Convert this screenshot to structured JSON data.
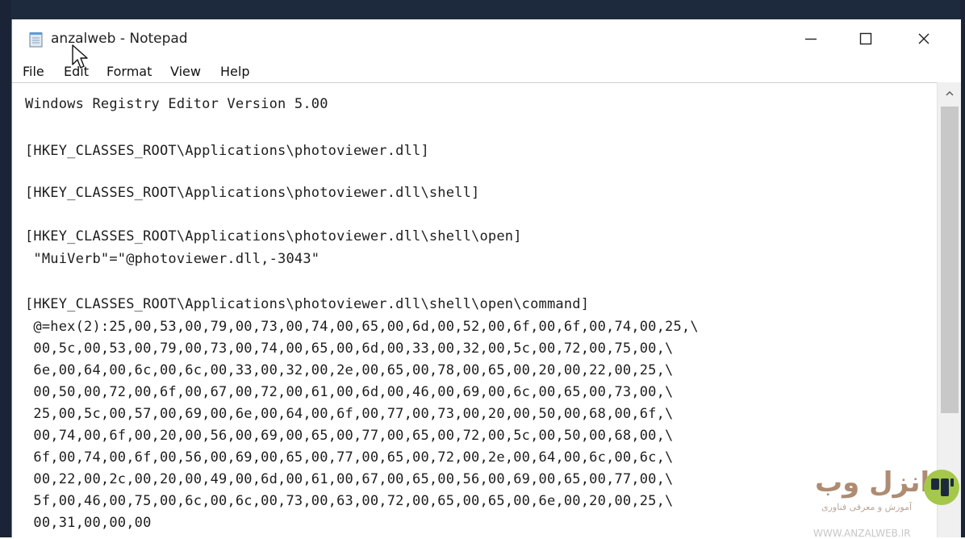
{
  "window": {
    "title": "anzalweb - Notepad",
    "icon": "notepad-icon"
  },
  "controls": {
    "minimize_icon": "minimize-icon",
    "maximize_icon": "maximize-icon",
    "close_icon": "close-icon"
  },
  "menu": [
    "File",
    "Edit",
    "Format",
    "View",
    "Help"
  ],
  "editor": {
    "lines": [
      "Windows Registry Editor Version 5.00",
      "",
      "[HKEY_CLASSES_ROOT\\Applications\\photoviewer.dll]",
      "",
      "[HKEY_CLASSES_ROOT\\Applications\\photoviewer.dll\\shell]",
      "",
      "[HKEY_CLASSES_ROOT\\Applications\\photoviewer.dll\\shell\\open]",
      " \"MuiVerb\"=\"@photoviewer.dll,-3043\"",
      "",
      "[HKEY_CLASSES_ROOT\\Applications\\photoviewer.dll\\shell\\open\\command]",
      " @=hex(2):25,00,53,00,79,00,73,00,74,00,65,00,6d,00,52,00,6f,00,6f,00,74,00,25,\\",
      " 00,5c,00,53,00,79,00,73,00,74,00,65,00,6d,00,33,00,32,00,5c,00,72,00,75,00,\\",
      " 6e,00,64,00,6c,00,6c,00,33,00,32,00,2e,00,65,00,78,00,65,00,20,00,22,00,25,\\",
      " 00,50,00,72,00,6f,00,67,00,72,00,61,00,6d,00,46,00,69,00,6c,00,65,00,73,00,\\",
      " 25,00,5c,00,57,00,69,00,6e,00,64,00,6f,00,77,00,73,00,20,00,50,00,68,00,6f,\\",
      " 00,74,00,6f,00,20,00,56,00,69,00,65,00,77,00,65,00,72,00,5c,00,50,00,68,00,\\",
      " 6f,00,74,00,6f,00,56,00,69,00,65,00,77,00,65,00,72,00,2e,00,64,00,6c,00,6c,\\",
      " 00,22,00,2c,00,20,00,49,00,6d,00,61,00,67,00,65,00,56,00,69,00,65,00,77,00,\\",
      " 5f,00,46,00,75,00,6c,00,6c,00,73,00,63,00,72,00,65,00,65,00,6e,00,20,00,25,\\",
      " 00,31,00,00,00"
    ]
  },
  "scrollbar": {
    "up_icon": "chevron-up-icon"
  },
  "watermark": {
    "brand": "انزل وب",
    "tagline": "آموزش و معرفی فناوری",
    "url": "WWW.ANZALWEB.IR"
  }
}
